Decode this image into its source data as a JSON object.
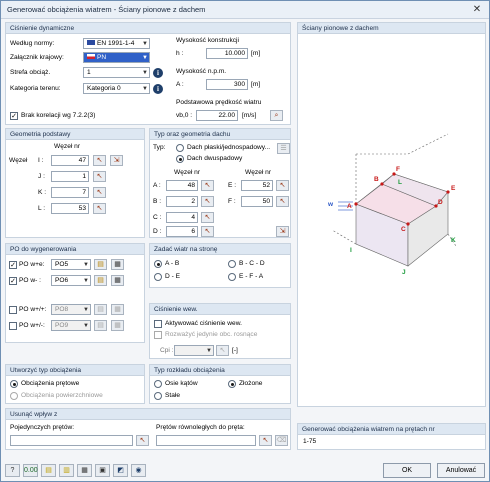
{
  "window": {
    "title": "Generować obciążenia wiatrem  -  Ściany pionowe z dachem"
  },
  "cisnienie": {
    "header": "Ciśnienie dynamiczne",
    "norma_label": "Według normy:",
    "norma_value": "EN 1991-1-4",
    "zal_label": "Załącznik krajowy:",
    "zal_value": "PN",
    "strefa_label": "Strefa obciąż.",
    "strefa_value": "1",
    "kategoria_label": "Kategoria terenu:",
    "kategoria_value": "Kategoria 0",
    "wys_label": "Wysokość konstrukcji",
    "h_label": "h :",
    "h_value": "10.000",
    "h_unit": "[m]",
    "npm_label": "Wysokość n.p.m.",
    "A_label": "A :",
    "A_value": "300",
    "A_unit": "[m]",
    "vb_label": "Podstawowa prędkość wiatru",
    "vb_sym": "vb,0 :",
    "vb_value": "22.00",
    "vb_unit": "[m/s]",
    "brak_label": "Brak korelacji wg 7.2.2(3)"
  },
  "geom": {
    "header": "Geometria podstawy",
    "wezel_label": "Węzeł",
    "col_header": "Węzeł nr",
    "rows": [
      {
        "l": "I :",
        "v": "47"
      },
      {
        "l": "J :",
        "v": "1"
      },
      {
        "l": "K :",
        "v": "7"
      },
      {
        "l": "L :",
        "v": "53"
      }
    ]
  },
  "dach": {
    "header": "Typ oraz geometria dachu",
    "typ_label": "Typ:",
    "opt1": "Dach płaski/jednospadowy...",
    "opt2": "Dach dwuspadowy",
    "col1": "Węzeł nr",
    "col2": "Węzeł nr",
    "left": [
      {
        "l": "A :",
        "v": "48"
      },
      {
        "l": "B :",
        "v": "2"
      },
      {
        "l": "C :",
        "v": "4"
      },
      {
        "l": "D :",
        "v": "6"
      }
    ],
    "right": [
      {
        "l": "E :",
        "v": "52"
      },
      {
        "l": "F :",
        "v": "50"
      }
    ]
  },
  "po": {
    "header": "PO do wygenerowania",
    "items": [
      {
        "label": "PO w+e:",
        "value": "PO5"
      },
      {
        "label": "PO w- :",
        "value": "PO6"
      },
      {
        "label": "PO w+/+:",
        "value": "PO8"
      },
      {
        "label": "PO w+/-:",
        "value": "PO9"
      }
    ]
  },
  "zadac": {
    "header": "Zadać wiatr na stronę",
    "opts": [
      "A - B",
      "B - C - D",
      "D - E",
      "E - F - A"
    ]
  },
  "wew": {
    "header": "Ciśnienie wew.",
    "aktyw": "Aktywować ciśnienie wew.",
    "rozw": "Rozważyć jedynie obc. rosnące",
    "cpi_label": "Cpi :",
    "cpi_unit": "[-]"
  },
  "utworzyc": {
    "header": "Utworzyć typ obciążenia",
    "opt1": "Obciążenia prętowe",
    "opt2": "Obciążenia powierzchniowe"
  },
  "rozklad": {
    "header": "Typ rozkładu obciążenia",
    "opt1": "Osie kątów",
    "opt2": "Złożone",
    "opt3": "Stałe"
  },
  "usunac": {
    "header": "Usunąć wpływ z",
    "poj_label": "Pojedynczych prętów:",
    "rown_label": "Prętów równoległych do pręta:"
  },
  "preview": {
    "header": "Ściany pionowe z dachem"
  },
  "generowac": {
    "header": "Generować obciążenia wiatrem na prętach nr",
    "value": "1-75"
  },
  "buttons": {
    "ok": "OK",
    "cancel": "Anulować"
  },
  "diagram": {
    "letters": [
      "A",
      "B",
      "C",
      "D",
      "E",
      "F",
      "I",
      "J",
      "K",
      "L",
      "w"
    ]
  }
}
